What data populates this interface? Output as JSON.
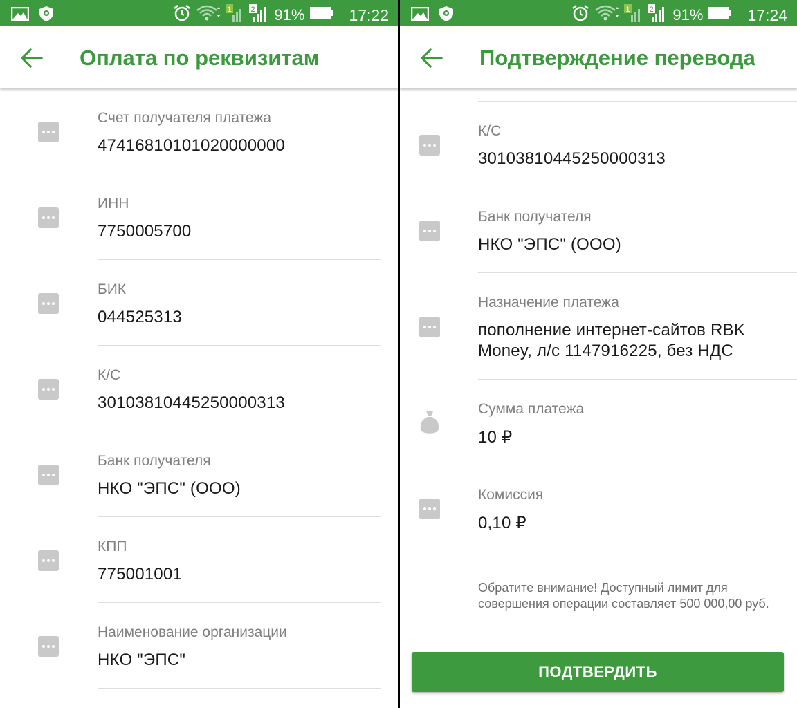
{
  "colors": {
    "accent": "#3d9a3f",
    "title": "#3a9a3c",
    "label": "#808080",
    "value": "#1a1a1a"
  },
  "left": {
    "status": {
      "battery": "91%",
      "time": "17:22",
      "sim1": "1",
      "sim2": "2"
    },
    "title": "Оплата по реквизитам",
    "fields": [
      {
        "label": "Счет получателя платежа",
        "value": "47416810101020000000",
        "icon": "more-dots-icon"
      },
      {
        "label": "ИНН",
        "value": "7750005700",
        "icon": "more-dots-icon"
      },
      {
        "label": "БИК",
        "value": "044525313",
        "icon": "more-dots-icon"
      },
      {
        "label": "К/С",
        "value": "30103810445250000313",
        "icon": "more-dots-icon"
      },
      {
        "label": "Банк получателя",
        "value": "НКО \"ЭПС\" (ООО)",
        "icon": "more-dots-icon"
      },
      {
        "label": "КПП",
        "value": "775001001",
        "icon": "more-dots-icon"
      },
      {
        "label": "Наименование организации",
        "value": "НКО \"ЭПС\"",
        "icon": "more-dots-icon"
      }
    ]
  },
  "right": {
    "status": {
      "battery": "91%",
      "time": "17:24",
      "sim1": "1",
      "sim2": "2"
    },
    "title": "Подтверждение перевода",
    "fields": [
      {
        "label": "К/С",
        "value": "30103810445250000313",
        "icon": "more-dots-icon"
      },
      {
        "label": "Банк получателя",
        "value": "НКО \"ЭПС\" (ООО)",
        "icon": "more-dots-icon"
      },
      {
        "label": "Назначение платежа",
        "value_line1": "пополнение интернет-сайтов RBK",
        "value_line2": "Money, л/с 1147916225, без НДС",
        "icon": "more-dots-icon"
      },
      {
        "label": "Сумма платежа",
        "value": "10 ₽",
        "icon": "money-bag-icon"
      },
      {
        "label": "Комиссия",
        "value": "0,10 ₽",
        "icon": "more-dots-icon"
      }
    ],
    "note": "Обратите внимание! Доступный лимит для совершения операции составляет 500 000,00 руб.",
    "confirm_label": "ПОДТВЕРДИТЬ"
  }
}
